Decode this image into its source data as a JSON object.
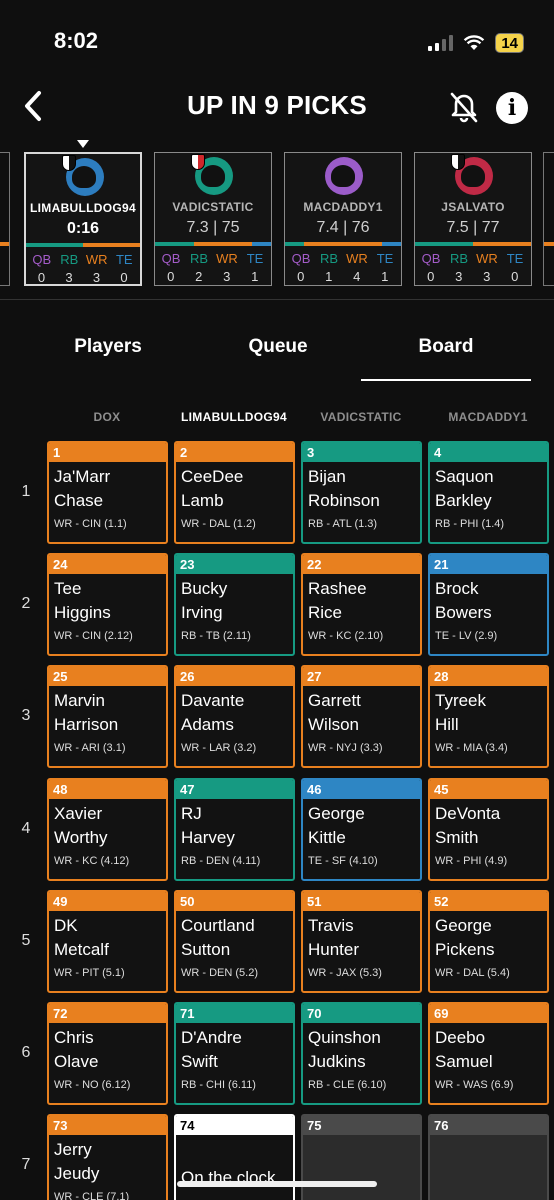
{
  "status_bar": {
    "time": "8:02",
    "battery": "14"
  },
  "header": {
    "title": "UP IN 9 PICKS"
  },
  "colors": {
    "WR": "#e8801f",
    "RB": "#169a82",
    "TE": "#2e86c4",
    "QB": "#a45cc9"
  },
  "drafters": [
    {
      "name": "LIMABULLDOG94",
      "stat": "0:16",
      "avatar_color": "#2d7dbf",
      "badge": "black",
      "active": true,
      "counts": [
        "0",
        "3",
        "3",
        "0"
      ]
    },
    {
      "name": "VADICSTATIC",
      "stat": "7.3 | 75",
      "avatar_color": "#169a82",
      "badge": "red",
      "active": false,
      "counts": [
        "0",
        "2",
        "3",
        "1"
      ]
    },
    {
      "name": "MACDADDY1",
      "stat": "7.4 | 76",
      "avatar_color": "#9b5cc9",
      "badge": "none",
      "active": false,
      "counts": [
        "0",
        "1",
        "4",
        "1"
      ]
    },
    {
      "name": "JSALVATO",
      "stat": "7.5 | 77",
      "avatar_color": "#c02a46",
      "badge": "black",
      "active": false,
      "counts": [
        "0",
        "3",
        "3",
        "0"
      ]
    }
  ],
  "position_labels": [
    "QB",
    "RB",
    "WR",
    "TE"
  ],
  "tabs": [
    "Players",
    "Queue",
    "Board"
  ],
  "active_tab": "Board",
  "board": {
    "columns": [
      "DOX",
      "LIMABULLDOG94",
      "VADICSTATIC",
      "MACDADDY1"
    ],
    "rounds": [
      "1",
      "2",
      "3",
      "4",
      "5",
      "6",
      "7"
    ],
    "picks": [
      [
        {
          "no": "1",
          "first": "Ja'Marr",
          "last": "Chase",
          "meta": "WR - CIN (1.1)",
          "pos": "WR"
        },
        {
          "no": "2",
          "first": "CeeDee",
          "last": "Lamb",
          "meta": "WR - DAL (1.2)",
          "pos": "WR"
        },
        {
          "no": "3",
          "first": "Bijan",
          "last": "Robinson",
          "meta": "RB - ATL (1.3)",
          "pos": "RB"
        },
        {
          "no": "4",
          "first": "Saquon",
          "last": "Barkley",
          "meta": "RB - PHI (1.4)",
          "pos": "RB"
        }
      ],
      [
        {
          "no": "24",
          "first": "Tee",
          "last": "Higgins",
          "meta": "WR - CIN (2.12)",
          "pos": "WR"
        },
        {
          "no": "23",
          "first": "Bucky",
          "last": "Irving",
          "meta": "RB - TB (2.11)",
          "pos": "RB"
        },
        {
          "no": "22",
          "first": "Rashee",
          "last": "Rice",
          "meta": "WR - KC (2.10)",
          "pos": "WR"
        },
        {
          "no": "21",
          "first": "Brock",
          "last": "Bowers",
          "meta": "TE - LV (2.9)",
          "pos": "TE"
        }
      ],
      [
        {
          "no": "25",
          "first": "Marvin",
          "last": "Harrison",
          "meta": "WR - ARI (3.1)",
          "pos": "WR"
        },
        {
          "no": "26",
          "first": "Davante",
          "last": "Adams",
          "meta": "WR - LAR (3.2)",
          "pos": "WR"
        },
        {
          "no": "27",
          "first": "Garrett",
          "last": "Wilson",
          "meta": "WR - NYJ (3.3)",
          "pos": "WR"
        },
        {
          "no": "28",
          "first": "Tyreek",
          "last": "Hill",
          "meta": "WR - MIA (3.4)",
          "pos": "WR"
        }
      ],
      [
        {
          "no": "48",
          "first": "Xavier",
          "last": "Worthy",
          "meta": "WR - KC (4.12)",
          "pos": "WR"
        },
        {
          "no": "47",
          "first": "RJ",
          "last": "Harvey",
          "meta": "RB - DEN (4.11)",
          "pos": "RB"
        },
        {
          "no": "46",
          "first": "George",
          "last": "Kittle",
          "meta": "TE - SF (4.10)",
          "pos": "TE"
        },
        {
          "no": "45",
          "first": "DeVonta",
          "last": "Smith",
          "meta": "WR - PHI (4.9)",
          "pos": "WR"
        }
      ],
      [
        {
          "no": "49",
          "first": "DK",
          "last": "Metcalf",
          "meta": "WR - PIT (5.1)",
          "pos": "WR"
        },
        {
          "no": "50",
          "first": "Courtland",
          "last": "Sutton",
          "meta": "WR - DEN (5.2)",
          "pos": "WR"
        },
        {
          "no": "51",
          "first": "Travis",
          "last": "Hunter",
          "meta": "WR - JAX (5.3)",
          "pos": "WR"
        },
        {
          "no": "52",
          "first": "George",
          "last": "Pickens",
          "meta": "WR - DAL (5.4)",
          "pos": "WR"
        }
      ],
      [
        {
          "no": "72",
          "first": "Chris",
          "last": "Olave",
          "meta": "WR - NO (6.12)",
          "pos": "WR"
        },
        {
          "no": "71",
          "first": "D'Andre",
          "last": "Swift",
          "meta": "RB - CHI (6.11)",
          "pos": "RB"
        },
        {
          "no": "70",
          "first": "Quinshon",
          "last": "Judkins",
          "meta": "RB - CLE (6.10)",
          "pos": "RB"
        },
        {
          "no": "69",
          "first": "Deebo",
          "last": "Samuel",
          "meta": "WR - WAS (6.9)",
          "pos": "WR"
        }
      ],
      [
        {
          "no": "73",
          "first": "Jerry",
          "last": "Jeudy",
          "meta": "WR - CLE (7.1)",
          "pos": "WR"
        },
        {
          "no": "74",
          "first": "On the clock",
          "last": "",
          "meta": "",
          "pos": "CLOCK"
        },
        {
          "no": "75",
          "first": "",
          "last": "",
          "meta": "",
          "pos": "EMPTY"
        },
        {
          "no": "76",
          "first": "",
          "last": "",
          "meta": "",
          "pos": "EMPTY"
        }
      ]
    ]
  }
}
